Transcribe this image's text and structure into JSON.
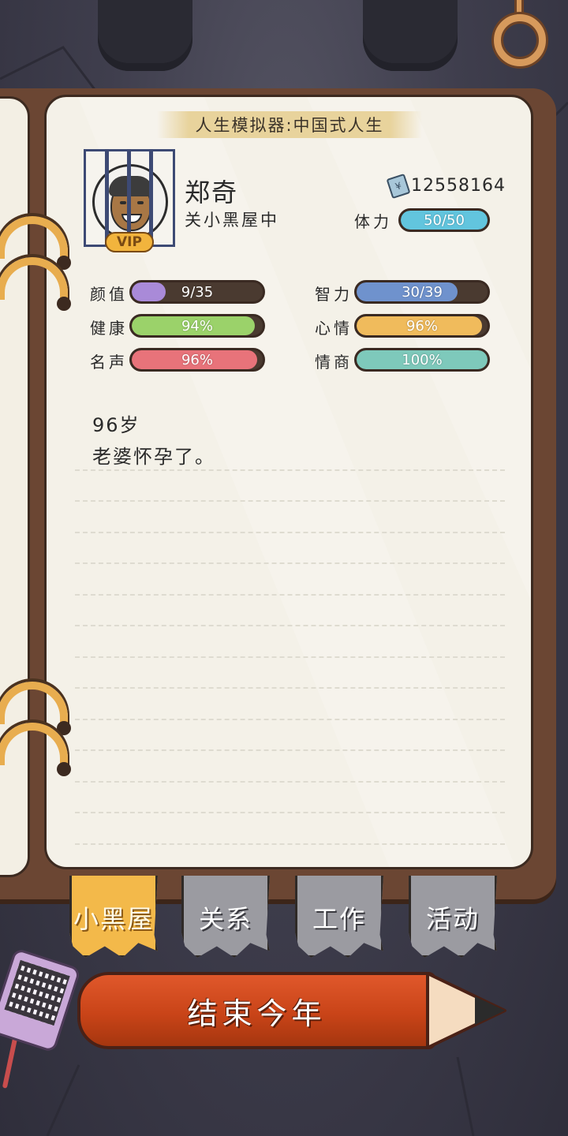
{
  "game": {
    "title": "人生模拟器:中国式人生"
  },
  "player": {
    "name": "郑奇",
    "status": "关小黑屋中",
    "vip_label": "VIP",
    "money": "12558164",
    "stamina_label": "体力",
    "stamina_value": "50/50",
    "stamina_fraction": 1.0
  },
  "stats": {
    "left": [
      {
        "label": "颜值",
        "value": "9/35",
        "fraction": 0.26,
        "color": "#a98ad8"
      },
      {
        "label": "健康",
        "value": "94%",
        "fraction": 0.94,
        "color": "#9bd26a"
      },
      {
        "label": "名声",
        "value": "96%",
        "fraction": 0.96,
        "color": "#e8737a"
      }
    ],
    "right": [
      {
        "label": "智力",
        "value": "30/39",
        "fraction": 0.77,
        "color": "#6f92cd"
      },
      {
        "label": "心情",
        "value": "96%",
        "fraction": 0.96,
        "color": "#f0bb5c"
      },
      {
        "label": "情商",
        "value": "100%",
        "fraction": 1.0,
        "color": "#7ec9bb"
      }
    ]
  },
  "log": {
    "age": "96岁",
    "event": "老婆怀孕了。"
  },
  "tabs": [
    {
      "label": "小黑屋",
      "active": true
    },
    {
      "label": "关系",
      "active": false
    },
    {
      "label": "工作",
      "active": false
    },
    {
      "label": "活动",
      "active": false
    }
  ],
  "actions": {
    "end_year": "结束今年"
  },
  "icons": {
    "money": "banknote-icon",
    "avatar": "caged-avatar-icon",
    "qr": "qr-code-icon",
    "hook": "ring-hook-icon"
  },
  "colors": {
    "stamina": "#62c5de",
    "book_cover": "#6b4633",
    "page": "#f4f1e8"
  }
}
